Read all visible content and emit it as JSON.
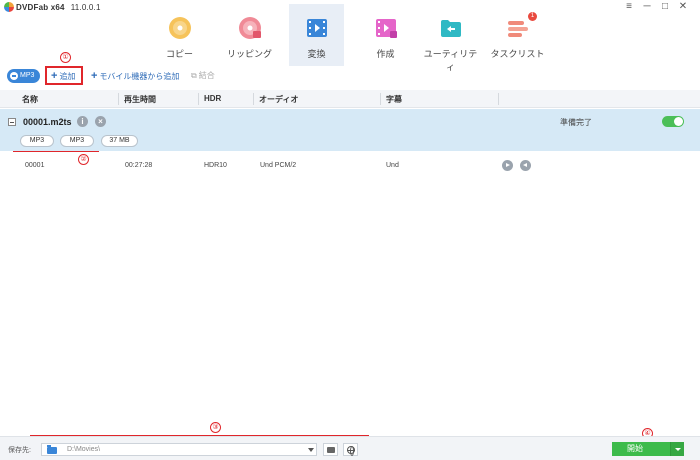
{
  "app": {
    "title": "DVDFab x64",
    "version": "11.0.0.1"
  },
  "window": {
    "menu_glyph": "≡",
    "minimize_glyph": "─",
    "maximize_glyph": "□",
    "close_glyph": "✕"
  },
  "tabs": [
    {
      "label": "コピー",
      "icon": "copy-disc-icon",
      "active": false
    },
    {
      "label": "リッピング",
      "icon": "ripper-disc-icon",
      "active": false
    },
    {
      "label": "変換",
      "icon": "converter-film-icon",
      "active": true
    },
    {
      "label": "作成",
      "icon": "creator-film-icon",
      "active": false
    },
    {
      "label": "ユーティリティ",
      "icon": "utilities-folder-icon",
      "active": false
    },
    {
      "label": "タスクリスト",
      "icon": "task-list-icon",
      "active": false,
      "badge": "1"
    }
  ],
  "toolbar": {
    "profile": "MP3",
    "add_label": "追加",
    "add_mobile_label": "モバイル機器から追加",
    "merge_label": "結合"
  },
  "table": {
    "columns": [
      "名称",
      "再生時間",
      "HDR",
      "オーディオ",
      "字幕"
    ],
    "file": {
      "name": "00001.m2ts",
      "status": "準備完了",
      "pills": [
        "MP3",
        "MP3",
        "37 MB"
      ],
      "enabled": true
    },
    "track": {
      "name": "00001",
      "duration": "00:27:28",
      "hdr": "HDR10",
      "audio": "Und  PCM/2",
      "subtitle": "Und"
    }
  },
  "bottom": {
    "save_label": "保存先:",
    "path": "D:\\Movies\\",
    "start_label": "開始"
  },
  "annotations": [
    "①",
    "②",
    "③",
    "④"
  ],
  "colors": {
    "accent_blue": "#3a86d8",
    "start_green": "#3dbb4b",
    "annotation_red": "#e0262b",
    "selected_row": "#d6e9f6"
  }
}
